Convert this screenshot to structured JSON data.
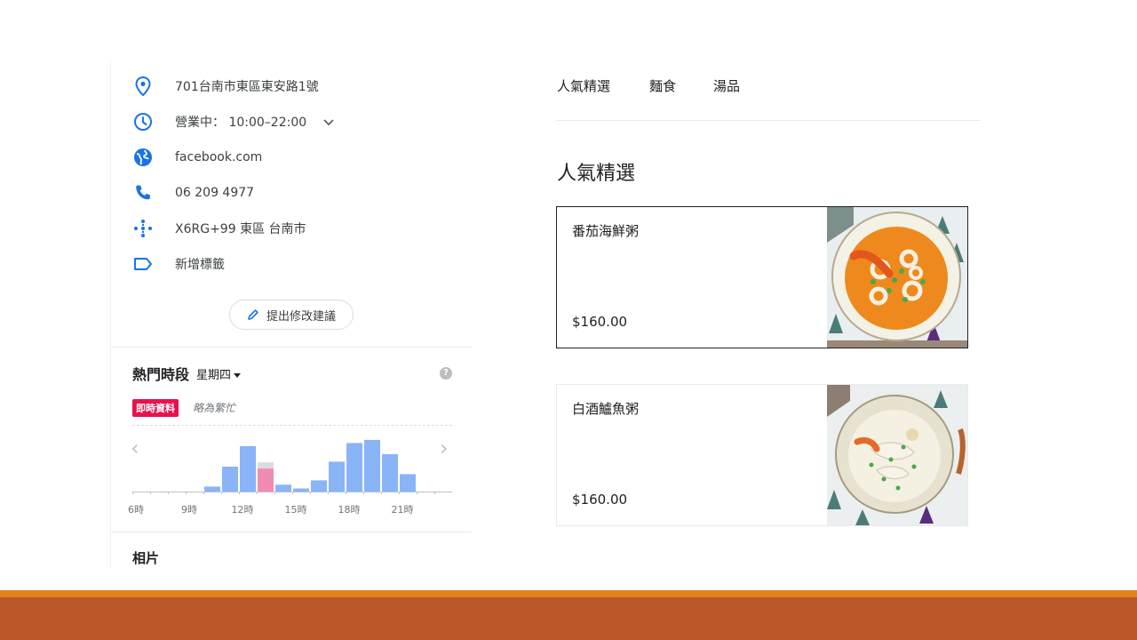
{
  "place": {
    "address": "701台南市東區東安路1號",
    "hours_status": "營業中：",
    "hours_range": "10:00–22:00",
    "website": "facebook.com",
    "phone": "06 209 4977",
    "plus_code": "X6RG+99 東區 台南市",
    "add_label": "新增標籤",
    "suggest_edit": "提出修改建議"
  },
  "popular_times": {
    "title": "熱門時段",
    "day": "星期四",
    "live_badge": "即時資料",
    "live_status": "略為繁忙"
  },
  "photos_title": "相片",
  "menu": {
    "tabs": [
      "人氣精選",
      "麵食",
      "湯品"
    ],
    "section_title": "人氣精選",
    "items": [
      {
        "name": "番茄海鮮粥",
        "price": "$160.00"
      },
      {
        "name": "白酒鱸魚粥",
        "price": "$160.00"
      }
    ]
  },
  "colors": {
    "accent_blue": "#1a73e8",
    "bar_blue": "#8ab4f8",
    "bar_live": "#f28bb3",
    "bar_live_usual": "#dadce0",
    "live_badge": "#e8114d",
    "footer_orange": "#e3821c",
    "footer_rust": "#bb582a"
  },
  "chart_data": {
    "type": "bar",
    "categories": [
      "6",
      "7",
      "8",
      "9",
      "10",
      "11",
      "12",
      "13",
      "14",
      "15",
      "16",
      "17",
      "18",
      "19",
      "20",
      "21",
      "22",
      "23"
    ],
    "tick_labels": [
      "6時",
      "9時",
      "12時",
      "15時",
      "18時",
      "21時"
    ],
    "tick_hours": [
      6,
      9,
      12,
      15,
      18,
      21
    ],
    "series": [
      {
        "values": [
          0,
          0,
          0,
          0,
          8,
          40,
          73,
          18,
          11,
          5,
          18,
          48,
          78,
          83,
          60,
          28,
          0,
          0
        ]
      }
    ],
    "live": {
      "hour": 13,
      "usual": 47,
      "now": 37
    },
    "ylim": [
      0,
      100
    ]
  }
}
